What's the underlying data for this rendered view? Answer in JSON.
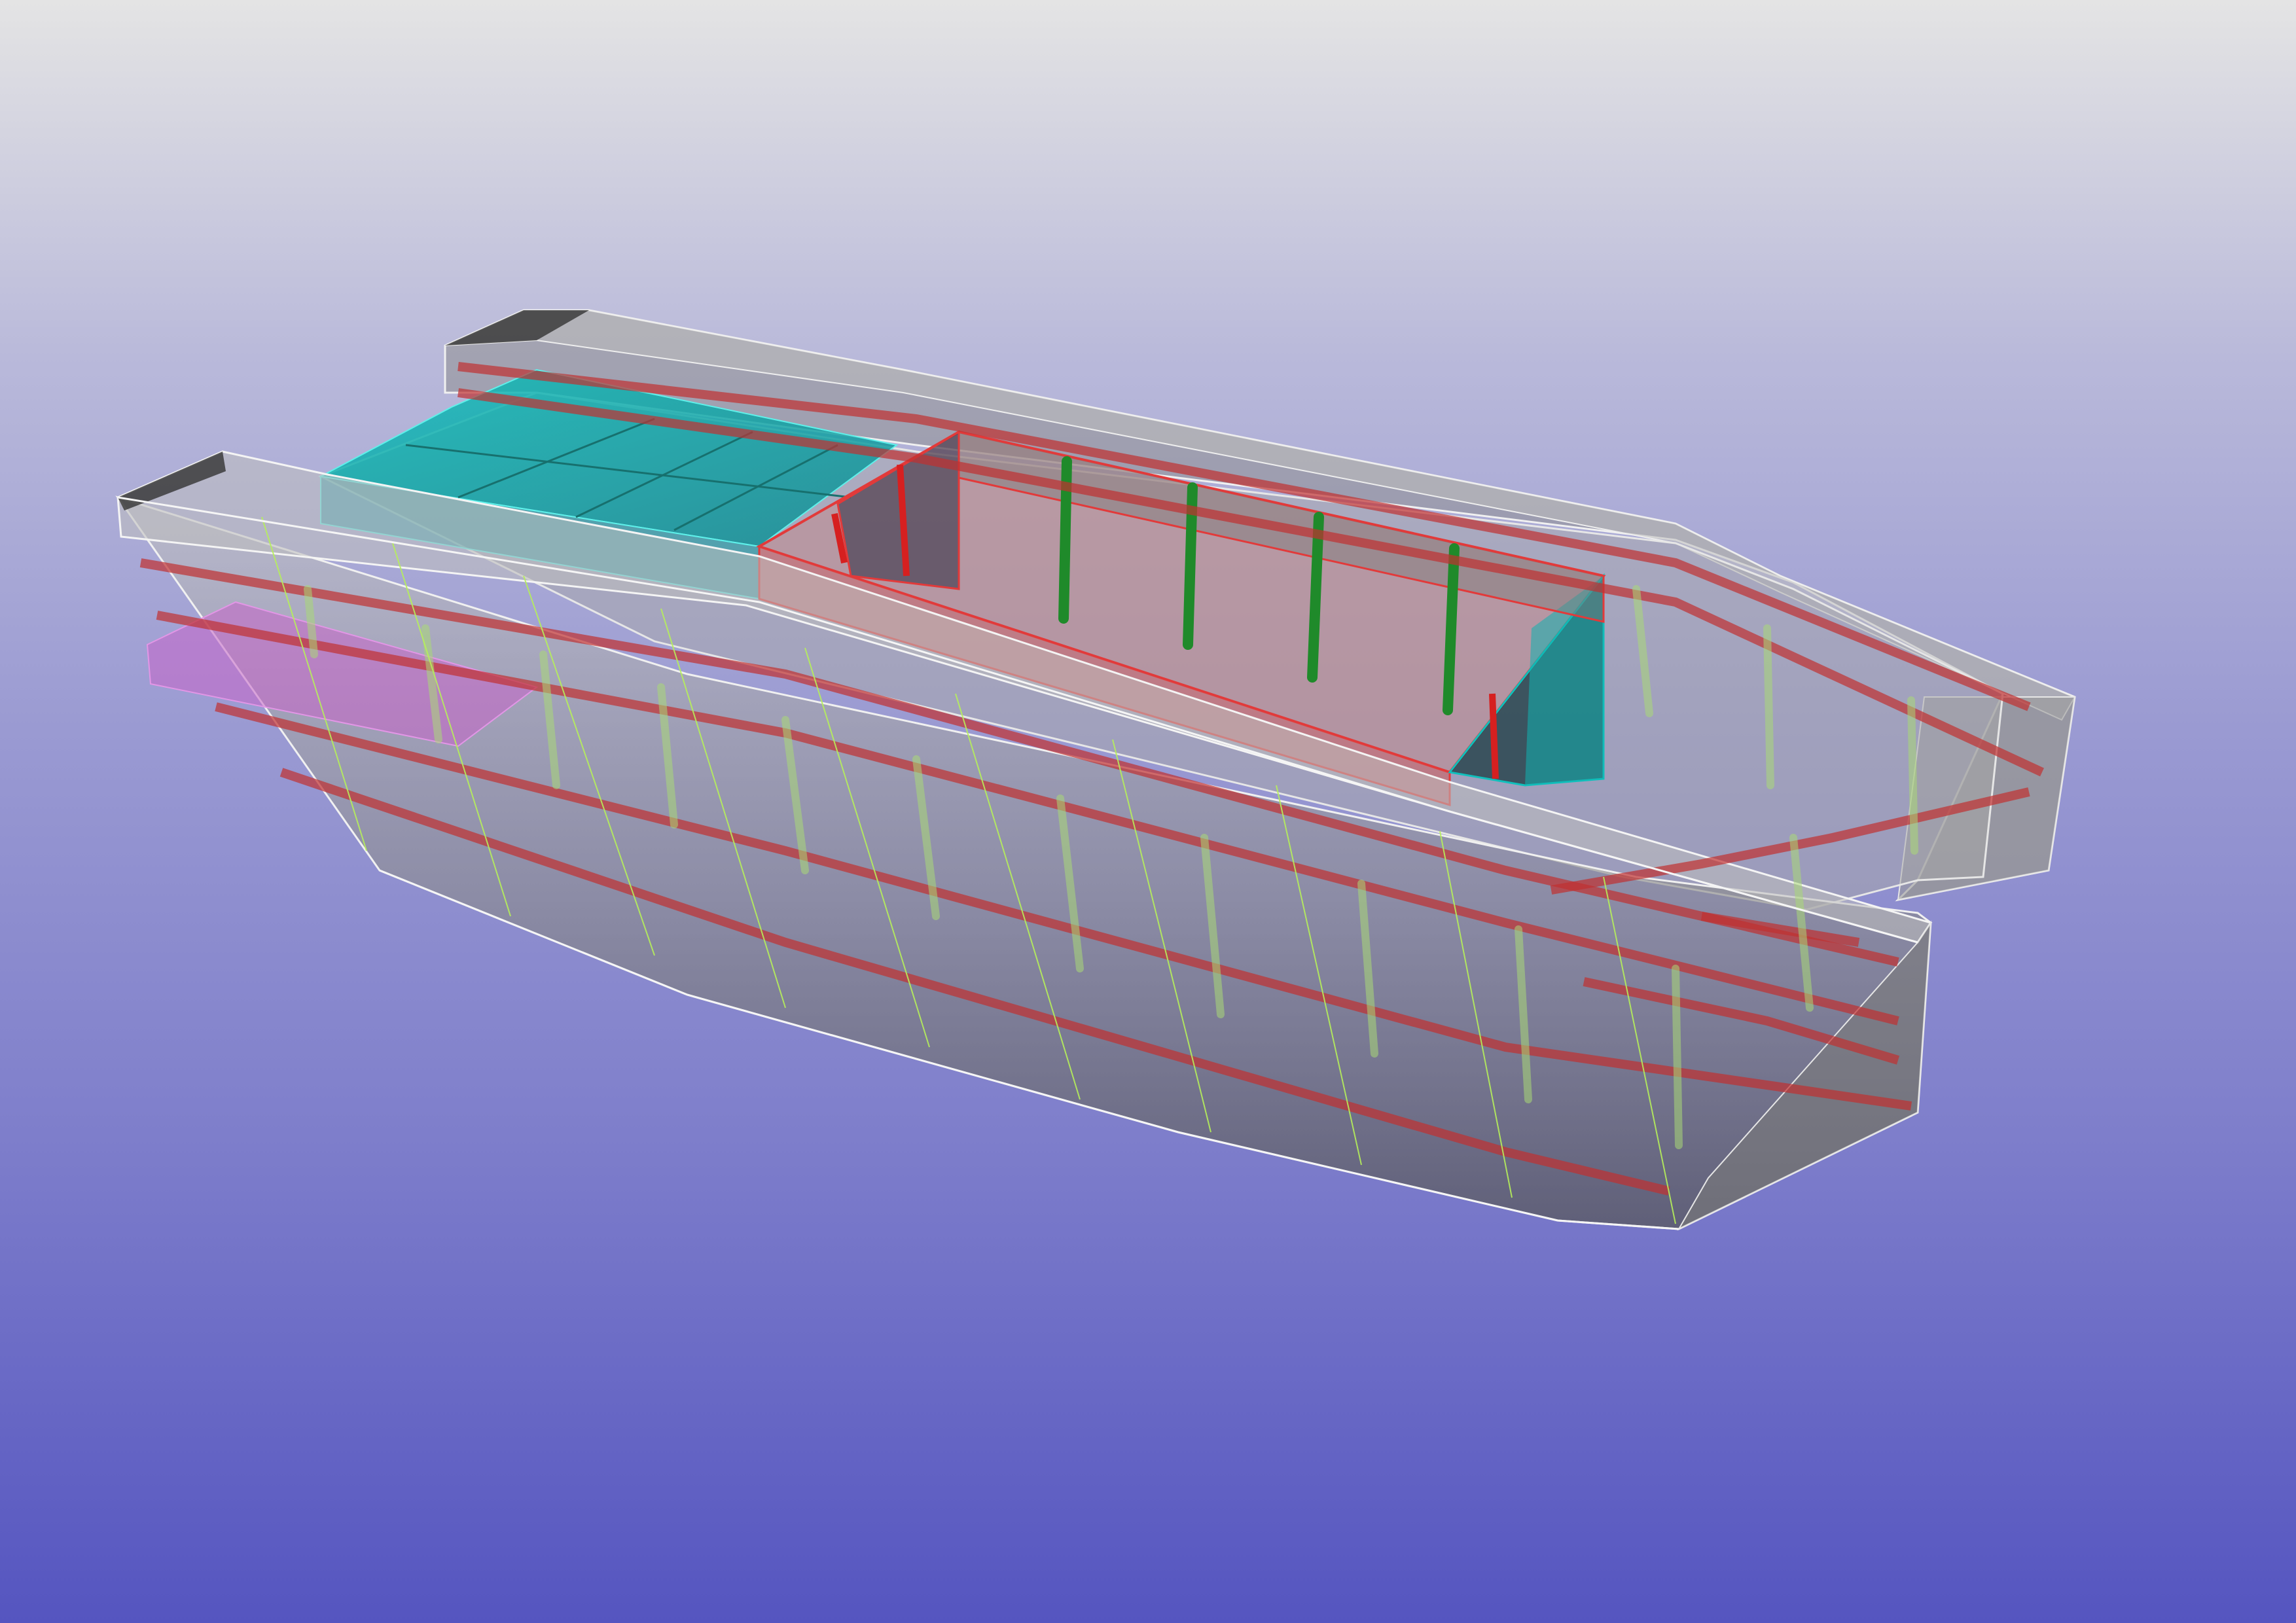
{
  "viewport": {
    "background_top": "#e4e4e4",
    "background_bottom": "#5555c0"
  },
  "model": {
    "hull_color": "#8e8e8e",
    "hull_edge_color": "#f2f2f2",
    "frame_color": "#b0d27a",
    "stringer_color": "#d23232",
    "tank_color": "#10b3b0",
    "compartment_color": "#cf6a6a",
    "post_color": "#1f8a2a",
    "highlight_color": "#c765c9"
  }
}
